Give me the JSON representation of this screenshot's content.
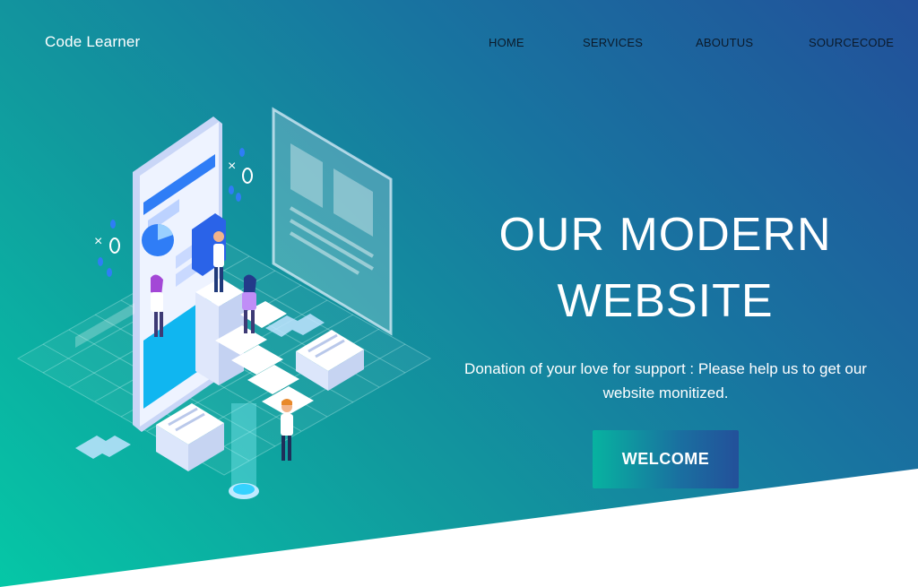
{
  "brand": {
    "name": "Code Learner"
  },
  "nav": {
    "items": [
      {
        "label": "HOME"
      },
      {
        "label": "SERVICES"
      },
      {
        "label": "ABOUTUS"
      },
      {
        "label": "SOURCECODE"
      }
    ]
  },
  "hero": {
    "title_line1": "OUR MODERN",
    "title_line2": "WEBSITE",
    "description": "Donation of your love for support : Please help us to get our website monitized.",
    "cta_label": "WELCOME"
  },
  "colors": {
    "gradient_start": "#05c7a6",
    "gradient_end": "#22509a",
    "text": "#ffffff",
    "nav_text": "#0b1a2a"
  },
  "icons": [
    "isometric-web-illustration"
  ]
}
